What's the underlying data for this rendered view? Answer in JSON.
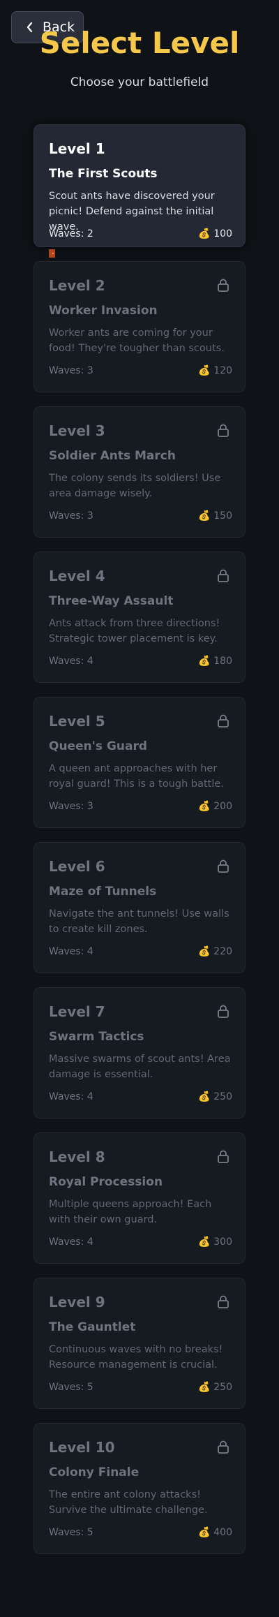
{
  "header": {
    "back_label": "Back",
    "title": "Select Level",
    "subtitle": "Choose your battlefield"
  },
  "icons": {
    "back": "chevron-left-icon",
    "lock": "lock-icon",
    "reward": "money-bag-icon",
    "start": "door-icon"
  },
  "colors": {
    "title": "#f5c74a",
    "background": "#0f1216",
    "card_unlocked": "#232834",
    "card_locked": "#161a21"
  },
  "levels": [
    {
      "name": "Level 1",
      "title": "The First Scouts",
      "description": "Scout ants have discovered your picnic! Defend against the initial wave.",
      "waves": "Waves: 2",
      "reward": "💰 100",
      "locked": false
    },
    {
      "name": "Level 2",
      "title": "Worker Invasion",
      "description": "Worker ants are coming for your food! They're tougher than scouts.",
      "waves": "Waves: 3",
      "reward": "💰 120",
      "locked": true
    },
    {
      "name": "Level 3",
      "title": "Soldier Ants March",
      "description": "The colony sends its soldiers! Use area damage wisely.",
      "waves": "Waves: 3",
      "reward": "💰 150",
      "locked": true
    },
    {
      "name": "Level 4",
      "title": "Three-Way Assault",
      "description": "Ants attack from three directions! Strategic tower placement is key.",
      "waves": "Waves: 4",
      "reward": "💰 180",
      "locked": true
    },
    {
      "name": "Level 5",
      "title": "Queen's Guard",
      "description": "A queen ant approaches with her royal guard! This is a tough battle.",
      "waves": "Waves: 3",
      "reward": "💰 200",
      "locked": true
    },
    {
      "name": "Level 6",
      "title": "Maze of Tunnels",
      "description": "Navigate the ant tunnels! Use walls to create kill zones.",
      "waves": "Waves: 4",
      "reward": "💰 220",
      "locked": true
    },
    {
      "name": "Level 7",
      "title": "Swarm Tactics",
      "description": "Massive swarms of scout ants! Area damage is essential.",
      "waves": "Waves: 4",
      "reward": "💰 250",
      "locked": true
    },
    {
      "name": "Level 8",
      "title": "Royal Procession",
      "description": "Multiple queens approach! Each with their own guard.",
      "waves": "Waves: 4",
      "reward": "💰 300",
      "locked": true
    },
    {
      "name": "Level 9",
      "title": "The Gauntlet",
      "description": "Continuous waves with no breaks! Resource management is crucial.",
      "waves": "Waves: 5",
      "reward": "💰 250",
      "locked": true
    },
    {
      "name": "Level 10",
      "title": "Colony Finale",
      "description": "The entire ant colony attacks! Survive the ultimate challenge.",
      "waves": "Waves: 5",
      "reward": "💰 400",
      "locked": true
    }
  ]
}
